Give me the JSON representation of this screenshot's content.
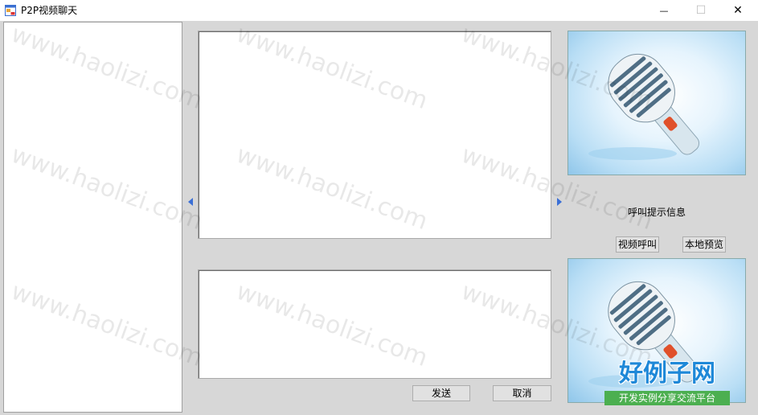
{
  "window": {
    "title": "P2P视频聊天",
    "minimize_glyph": "—",
    "maximize_glyph": "☐",
    "close_glyph": "✕",
    "icon": "app-window-icon"
  },
  "call": {
    "info_text": "呼叫提示信息",
    "video_call_label": "视频呼叫",
    "local_preview_label": "本地预览",
    "remote_video_image": "microphone-image",
    "local_video_image": "microphone-image"
  },
  "chat": {
    "send_label": "发送",
    "cancel_label": "取消"
  },
  "watermark": {
    "text": "www.haolizi.com",
    "badge_title": "好例子网",
    "badge_subtitle": "开发实例分享交流平台"
  },
  "colors": {
    "client_background": "#d7d7d7",
    "accent_arrow": "#3a6fd6",
    "badge_blue": "#1e88d8",
    "badge_green": "#4caf50"
  }
}
